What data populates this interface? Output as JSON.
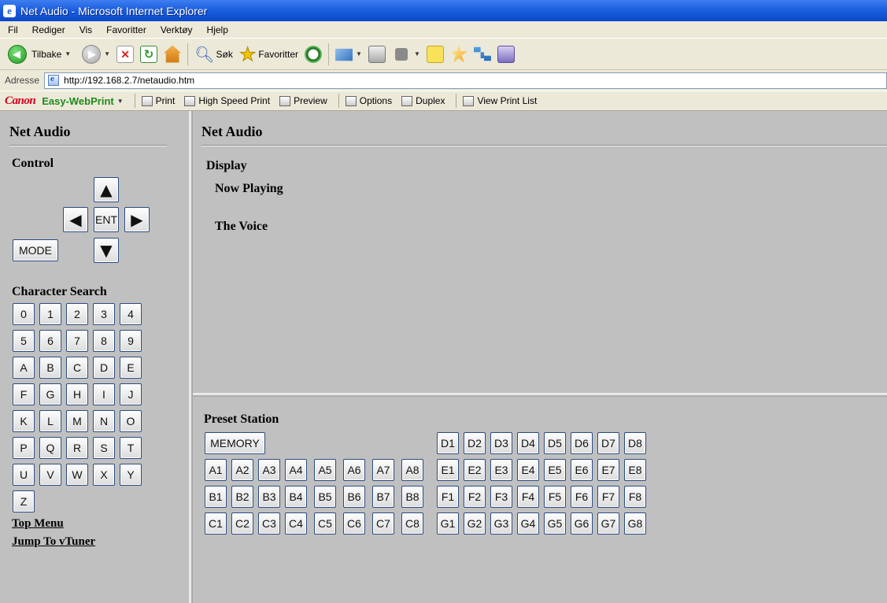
{
  "browser": {
    "title": "Net Audio - Microsoft Internet Explorer",
    "menu": [
      "Fil",
      "Rediger",
      "Vis",
      "Favoritter",
      "Verktøy",
      "Hjelp"
    ],
    "toolbar": {
      "back_label": "Tilbake",
      "search_label": "Søk",
      "favorites_label": "Favoritter"
    },
    "address_label": "Adresse",
    "url": "http://192.168.2.7/netaudio.htm",
    "canon": {
      "brand": "Canon",
      "product": "Easy-WebPrint",
      "print": "Print",
      "high_speed_print": "High Speed Print",
      "preview": "Preview",
      "options": "Options",
      "duplex": "Duplex",
      "view_print_list": "View Print List"
    }
  },
  "left": {
    "title": "Net Audio",
    "control_label": "Control",
    "control": {
      "up": "▲",
      "left": "◀",
      "enter": "ENT",
      "right": "▶",
      "down": "▼",
      "mode": "MODE"
    },
    "char_search_label": "Character Search",
    "chars": [
      [
        "0",
        "1",
        "2",
        "3",
        "4"
      ],
      [
        "5",
        "6",
        "7",
        "8",
        "9"
      ],
      [
        "A",
        "B",
        "C",
        "D",
        "E"
      ],
      [
        "F",
        "G",
        "H",
        "I",
        "J"
      ],
      [
        "K",
        "L",
        "M",
        "N",
        "O"
      ],
      [
        "P",
        "Q",
        "R",
        "S",
        "T"
      ],
      [
        "U",
        "V",
        "W",
        "X",
        "Y"
      ],
      [
        "Z"
      ]
    ],
    "links": {
      "top_menu": "Top Menu",
      "vtuner": "Jump To vTuner"
    }
  },
  "display": {
    "title": "Net Audio",
    "label": "Display",
    "line1": "Now Playing",
    "line2": "The Voice"
  },
  "preset": {
    "label": "Preset Station",
    "memory": "MEMORY",
    "left_rows": [
      [
        "A1",
        "A2",
        "A3",
        "A4",
        "A5",
        "A6",
        "A7",
        "A8"
      ],
      [
        "B1",
        "B2",
        "B3",
        "B4",
        "B5",
        "B6",
        "B7",
        "B8"
      ],
      [
        "C1",
        "C2",
        "C3",
        "C4",
        "C5",
        "C6",
        "C7",
        "C8"
      ]
    ],
    "right_rows": [
      [
        "D1",
        "D2",
        "D3",
        "D4",
        "D5",
        "D6",
        "D7",
        "D8"
      ],
      [
        "E1",
        "E2",
        "E3",
        "E4",
        "E5",
        "E6",
        "E7",
        "E8"
      ],
      [
        "F1",
        "F2",
        "F3",
        "F4",
        "F5",
        "F6",
        "F7",
        "F8"
      ],
      [
        "G1",
        "G2",
        "G3",
        "G4",
        "G5",
        "G6",
        "G7",
        "G8"
      ]
    ]
  }
}
